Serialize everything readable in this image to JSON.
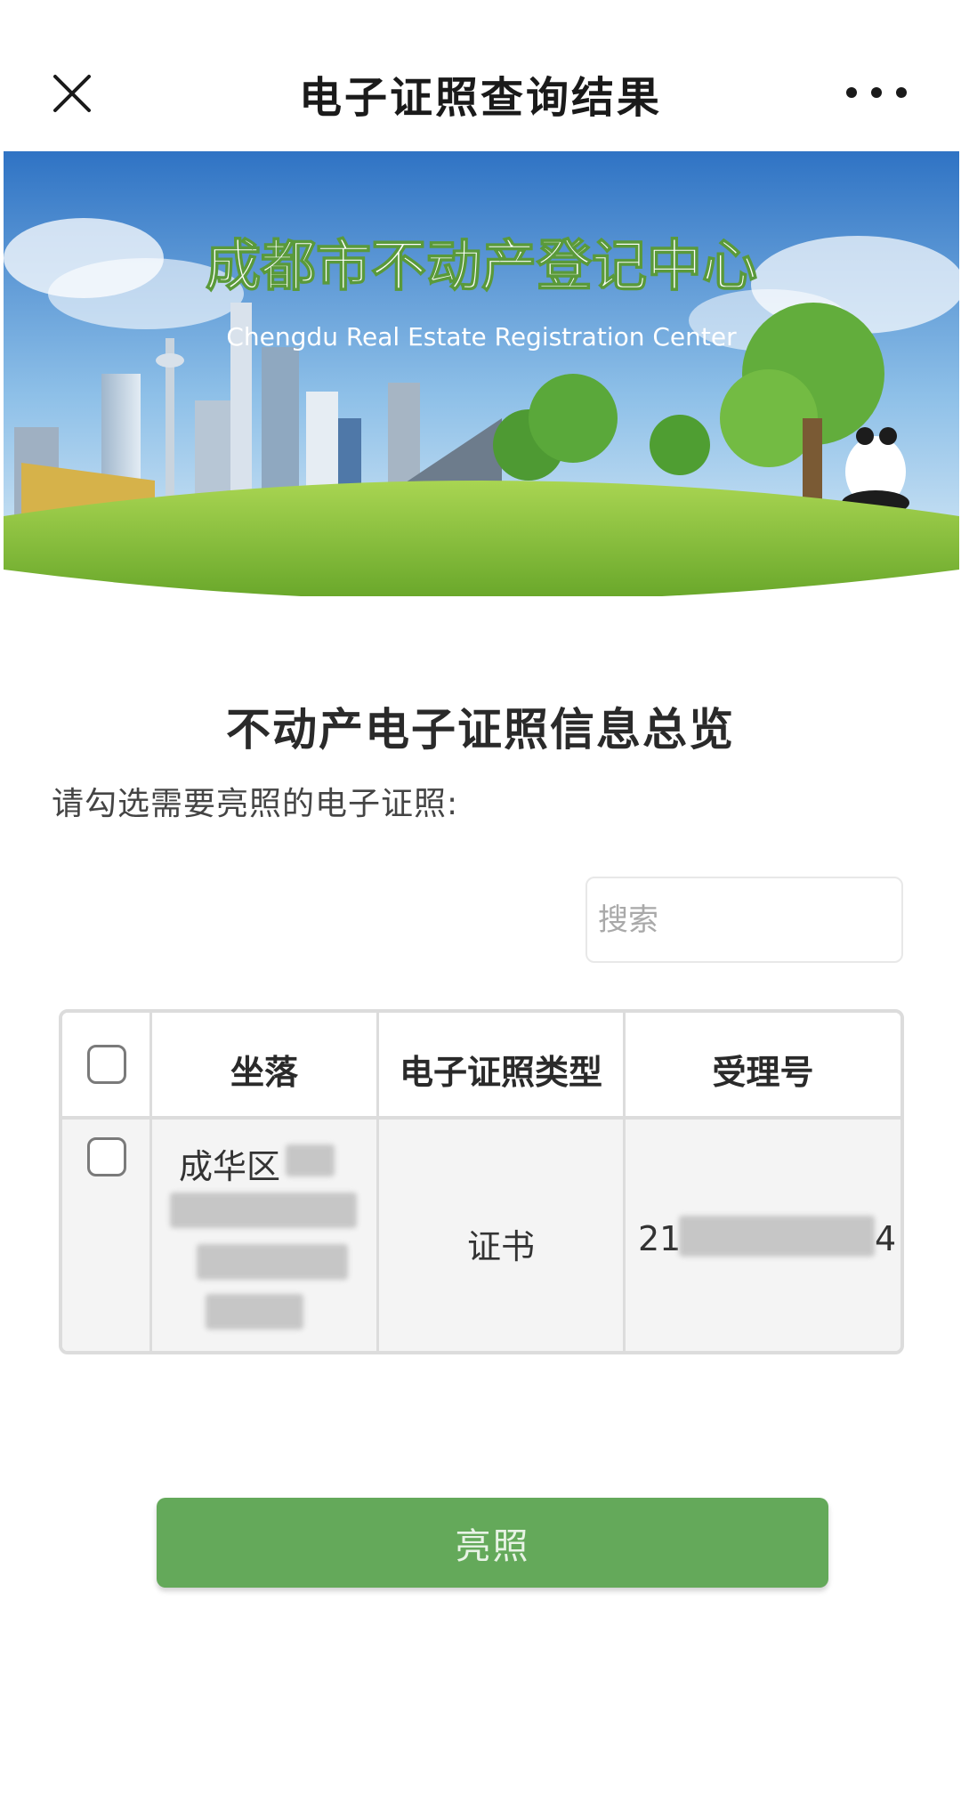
{
  "navbar": {
    "title": "电子证照查询结果",
    "close_icon": "close-icon",
    "more_icon": "more-dots-icon"
  },
  "banner": {
    "title": "成都市不动产登记中心",
    "subtitle": "Chengdu Real Estate Registration Center"
  },
  "content": {
    "heading": "不动产电子证照信息总览",
    "instruction": "请勾选需要亮照的电子证照:",
    "search_placeholder": "搜索"
  },
  "table": {
    "columns": [
      "坐落",
      "电子证照类型",
      "受理号"
    ],
    "rows": [
      {
        "location": "成华区",
        "type": "证书",
        "acceptance_no_start": "21",
        "acceptance_no_end": "4"
      }
    ]
  },
  "actions": {
    "show_license": "亮照"
  },
  "colors": {
    "button_green": "#64a95a",
    "sky_blue": "#3f86d0",
    "grass_green": "#8cc43f",
    "title_text": "#1a1a1a"
  }
}
